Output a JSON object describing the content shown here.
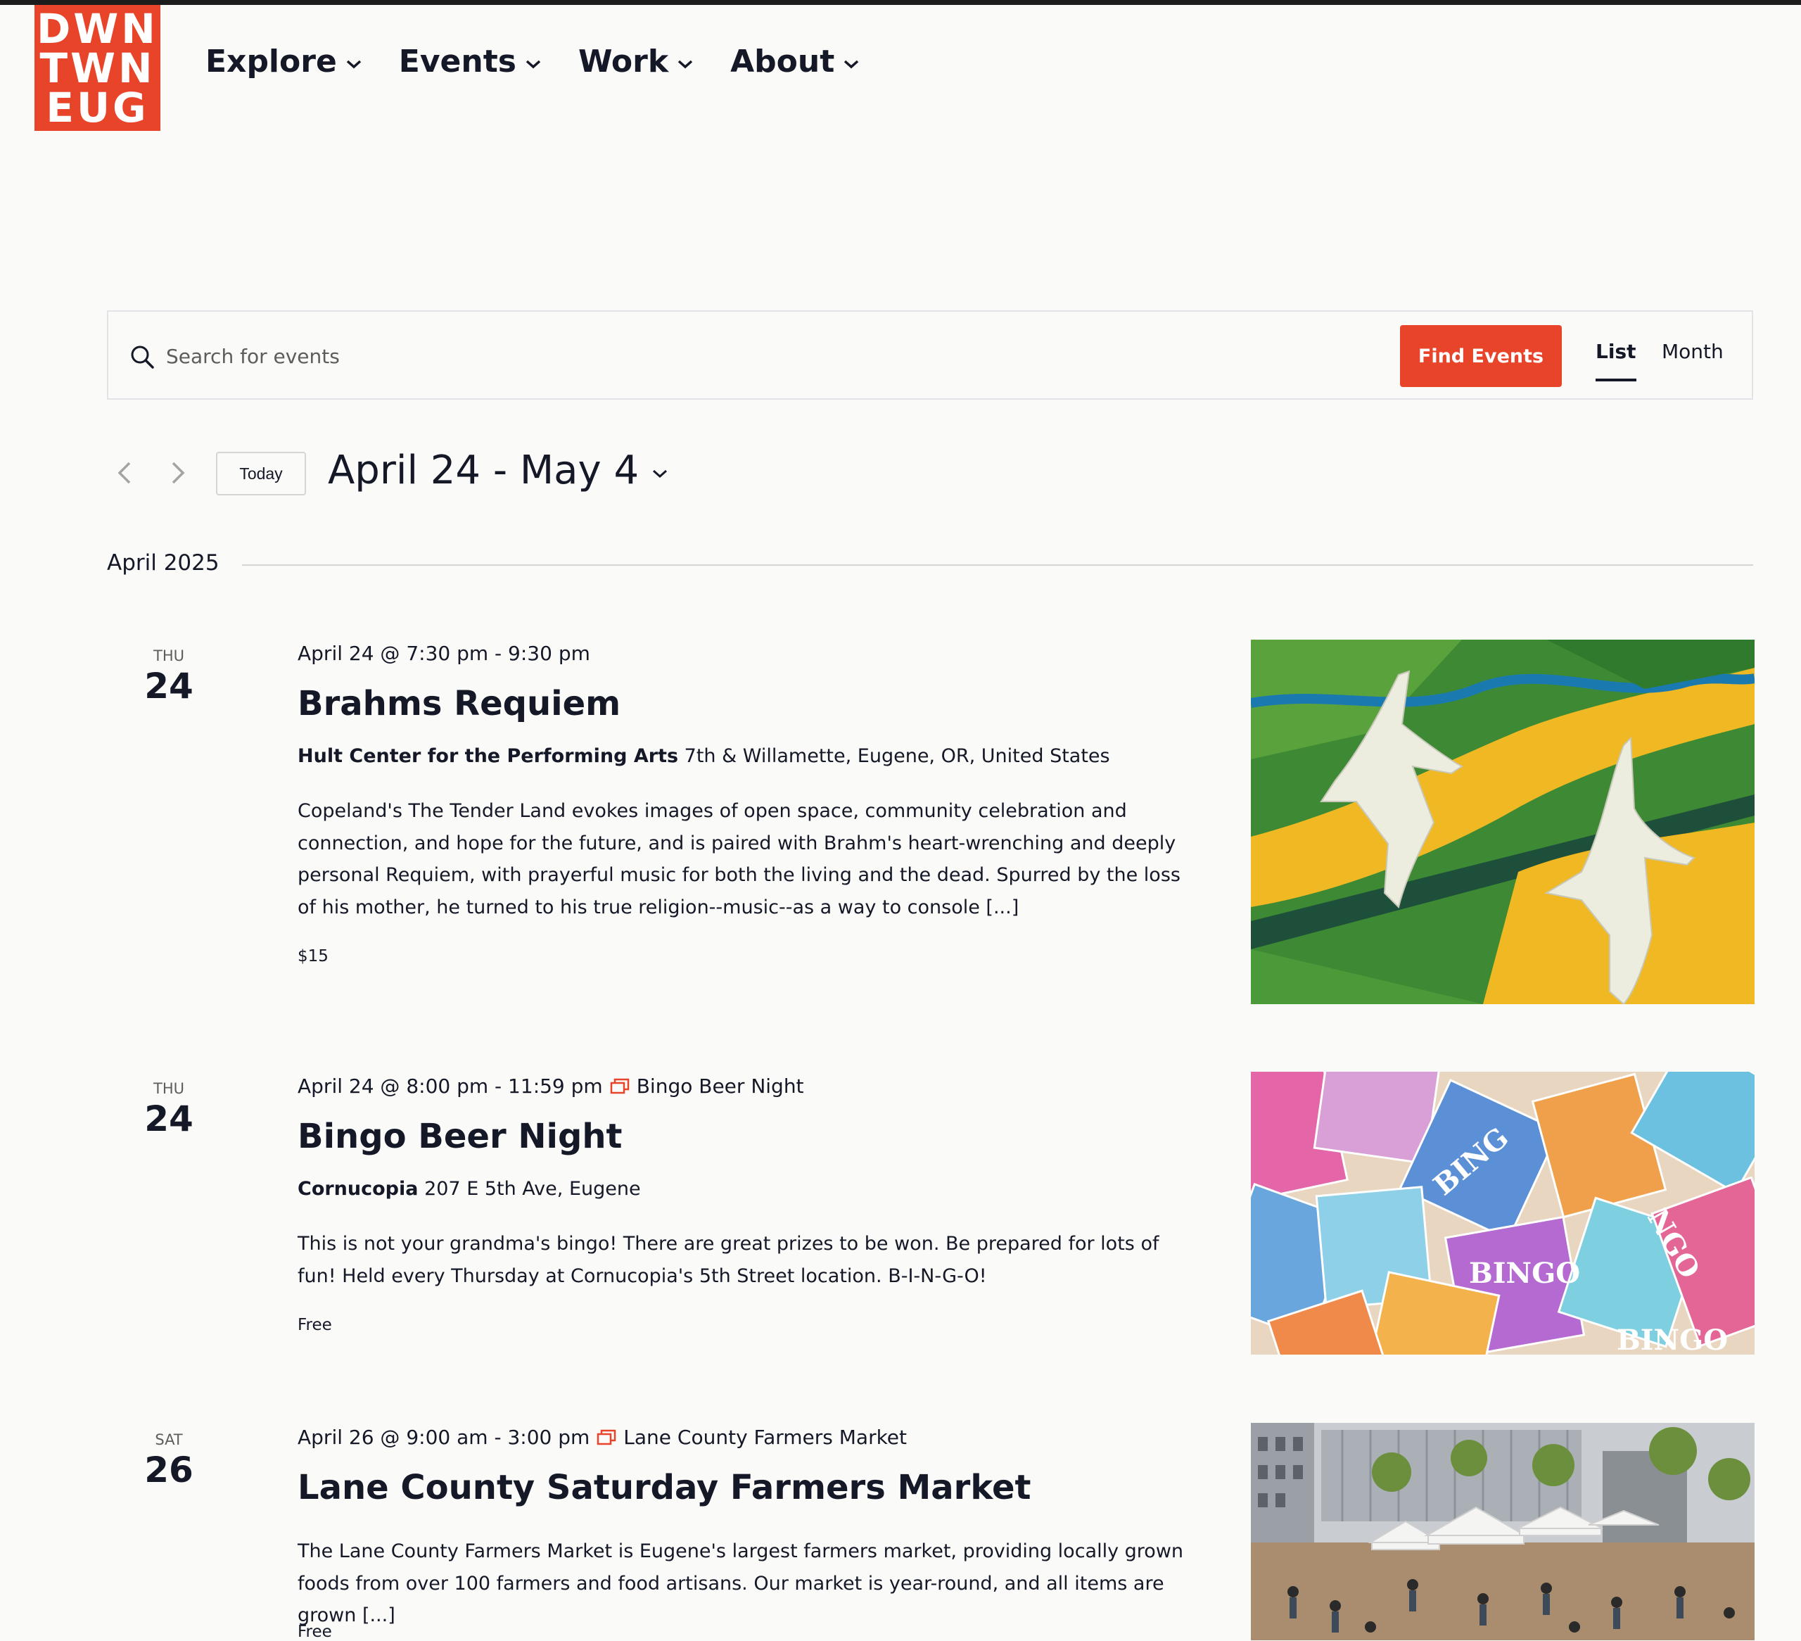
{
  "logo": {
    "lines": [
      "DWN",
      "TWN",
      "EUG"
    ]
  },
  "nav": {
    "items": [
      {
        "label": "Explore"
      },
      {
        "label": "Events"
      },
      {
        "label": "Work"
      },
      {
        "label": "About"
      }
    ]
  },
  "search": {
    "placeholder": "Search for events",
    "value": "",
    "button_label": "Find Events",
    "views": [
      "List",
      "Month"
    ],
    "active_view": "List"
  },
  "date_nav": {
    "today_label": "Today",
    "range_label": "April 24 - May 4"
  },
  "month_separator": "April 2025",
  "colors": {
    "accent": "#e8442a",
    "text": "#141827",
    "muted": "#5d5d5d",
    "background": "#fafaf8"
  },
  "events": [
    {
      "dow": "THU",
      "day": "24",
      "datetime": "April 24 @ 7:30 pm - 9:30 pm",
      "series": "",
      "title": "Brahms Requiem",
      "venue_name": "Hult Center for the Performing Arts",
      "venue_address": "7th & Willamette, Eugene, OR, United States",
      "description": "Copeland's The Tender Land evokes images of open space, community celebration and connection, and hope for the future, and is paired with Brahm's heart-wrenching and deeply personal Requiem, with prayerful music for both the living and the dead. Spurred by the loss of his mother, he turned to his true religion--music--as a way to console [...]",
      "cost": "$15",
      "image": "cranes-over-farmland-illustration"
    },
    {
      "dow": "THU",
      "day": "24",
      "datetime": "April 24 @ 8:00 pm - 11:59 pm",
      "series": "Bingo Beer Night",
      "title": "Bingo Beer Night",
      "venue_name": "Cornucopia",
      "venue_address": "207 E 5th Ave, Eugene",
      "description": "This is not your grandma's bingo! There are great prizes to be won. Be prepared for lots of fun! Held every Thursday at Cornucopia's 5th Street location. B-I-N-G-O!",
      "cost": "Free",
      "image": "bingo-cards-photo"
    },
    {
      "dow": "SAT",
      "day": "26",
      "datetime": "April 26 @ 9:00 am - 3:00 pm",
      "series": "Lane County Farmers Market",
      "title": "Lane County Saturday Farmers Market",
      "venue_name": "",
      "venue_address": "",
      "description": "The Lane County Farmers Market is Eugene's largest farmers market, providing locally grown foods from over 100 farmers and food artisans. Our market is year-round, and all items are grown [...]",
      "cost": "Free",
      "image": "farmers-market-photo"
    }
  ]
}
